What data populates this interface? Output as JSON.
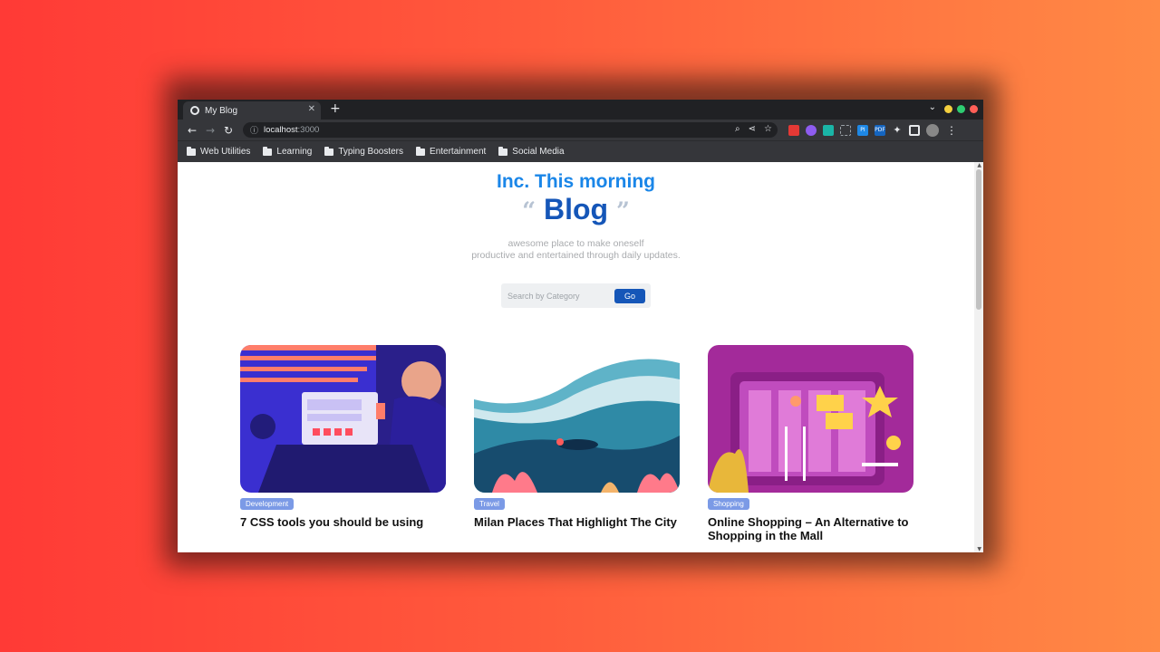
{
  "browser": {
    "tab_title": "My Blog",
    "tab_close": "✕",
    "new_tab": "+",
    "tab_menu": "⌄",
    "url_host": "localhost",
    "url_port": ":3000",
    "window_controls": {
      "minimize_color": "#f4d03f",
      "maximize_color": "#2ecc71",
      "close_color": "#ff5f57"
    },
    "bookmarks": [
      "Web Utilities",
      "Learning",
      "Typing Boosters",
      "Entertainment",
      "Social Media"
    ],
    "extension_icons": [
      "puzzle-red-icon",
      "bolt-purple-icon",
      "teal-ext-icon",
      "capture-icon",
      "pi-ext-icon",
      "pdf-ext-icon",
      "extensions-icon",
      "sidepanel-icon",
      "profile-icon"
    ],
    "ext_labels": {
      "pi": "PI",
      "pdf": "PDF"
    }
  },
  "page": {
    "kicker": "Inc. This morning",
    "title": "Blog",
    "quote_open": "“",
    "quote_close": "”",
    "subtitle_line1": "awesome place to make oneself",
    "subtitle_line2": "productive and entertained through daily updates.",
    "search_placeholder": "Search by Category",
    "search_button": "Go"
  },
  "posts": [
    {
      "tag": "Development",
      "title": "7 CSS tools you should be using",
      "image": "illustration-designer-at-laptop"
    },
    {
      "tag": "Travel",
      "title": "Milan Places That Highlight The City",
      "image": "illustration-diver-underwater"
    },
    {
      "tag": "Shopping",
      "title": "Online Shopping – An Alternative to Shopping in the Mall",
      "image": "illustration-team-kanban-board"
    }
  ],
  "colors": {
    "kicker": "#1a86e8",
    "title": "#1556b8",
    "tag": "#7b9ae6",
    "button": "#1556b8"
  }
}
